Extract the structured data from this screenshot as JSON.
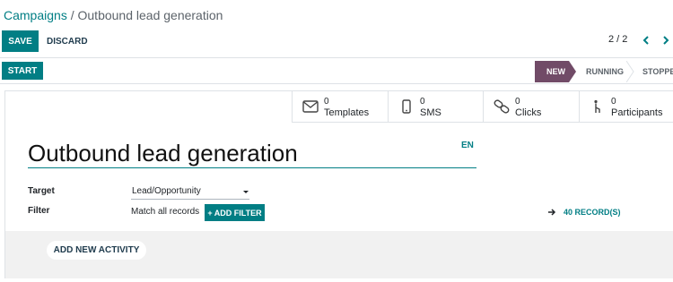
{
  "breadcrumb": {
    "parent": "Campaigns",
    "separator": " / ",
    "current": "Outbound lead generation"
  },
  "toolbar": {
    "save_label": "SAVE",
    "discard_label": "DISCARD"
  },
  "pager": {
    "value": "2 / 2"
  },
  "header": {
    "start_label": "START",
    "statuses": [
      {
        "label": "NEW",
        "active": true
      },
      {
        "label": "RUNNING",
        "active": false
      },
      {
        "label": "STOPPED",
        "active": false
      }
    ]
  },
  "smart_buttons": [
    {
      "count": "0",
      "label": "Templates",
      "icon": "envelope-icon"
    },
    {
      "count": "0",
      "label": "SMS",
      "icon": "mobile-icon"
    },
    {
      "count": "0",
      "label": "Clicks",
      "icon": "link-icon"
    },
    {
      "count": "0",
      "label": "Participants",
      "icon": "participants-icon"
    }
  ],
  "form": {
    "name": "Outbound lead generation",
    "language": "EN",
    "target_label": "Target",
    "target_value": "Lead/Opportunity",
    "filter_label": "Filter",
    "filter_text": "Match all records",
    "add_filter_label": "+ ADD FILTER",
    "records_label": "40 RECORD(S)"
  },
  "activities": {
    "add_label": "ADD NEW ACTIVITY"
  },
  "colors": {
    "primary": "#017e84",
    "status_active": "#714b67",
    "activity_bg": "#f1f1f1"
  }
}
